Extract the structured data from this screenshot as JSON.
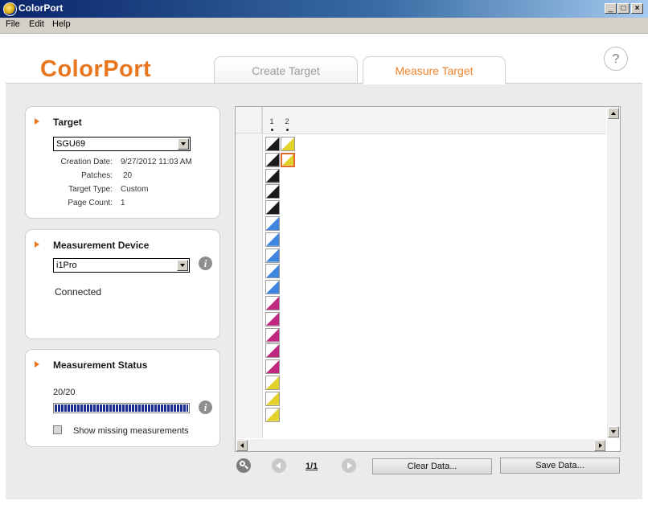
{
  "window": {
    "title": "ColorPort"
  },
  "menu": {
    "items": [
      "File",
      "Edit",
      "Help"
    ]
  },
  "header": {
    "logo": "ColorPort",
    "tabs": [
      {
        "label": "Create Target",
        "active": false
      },
      {
        "label": "Measure Target",
        "active": true
      }
    ],
    "help_label": "?"
  },
  "target_panel": {
    "title": "Target",
    "selected": "SGU69",
    "info": [
      {
        "label": "Creation Date:",
        "value": "9/27/2012 11:03 AM"
      },
      {
        "label": "Patches:",
        "value": "20"
      },
      {
        "label": "Target Type:",
        "value": "Custom"
      },
      {
        "label": "Page Count:",
        "value": "1"
      }
    ]
  },
  "device_panel": {
    "title": "Measurement Device",
    "selected": "i1Pro",
    "status": "Connected",
    "info_icon": "i"
  },
  "status_panel": {
    "title": "Measurement Status",
    "count": "20/20",
    "progress": 1.0,
    "info_icon": "i",
    "checkbox_label": "Show missing measurements",
    "checkbox_checked": false
  },
  "grid": {
    "columns": [
      "1",
      "2"
    ],
    "patches": [
      {
        "col": 1,
        "row": 1,
        "color": "#1a1a1a"
      },
      {
        "col": 2,
        "row": 1,
        "color": "#e3d22a"
      },
      {
        "col": 1,
        "row": 2,
        "color": "#1a1a1a"
      },
      {
        "col": 2,
        "row": 2,
        "color": "#e3d22a",
        "selected": true
      },
      {
        "col": 1,
        "row": 3,
        "color": "#1a1a1a"
      },
      {
        "col": 1,
        "row": 4,
        "color": "#1a1a1a"
      },
      {
        "col": 1,
        "row": 5,
        "color": "#1a1a1a"
      },
      {
        "col": 1,
        "row": 6,
        "color": "#3f86e0"
      },
      {
        "col": 1,
        "row": 7,
        "color": "#3f86e0"
      },
      {
        "col": 1,
        "row": 8,
        "color": "#3f86e0"
      },
      {
        "col": 1,
        "row": 9,
        "color": "#3f86e0"
      },
      {
        "col": 1,
        "row": 10,
        "color": "#3f86e0"
      },
      {
        "col": 1,
        "row": 11,
        "color": "#c0287f"
      },
      {
        "col": 1,
        "row": 12,
        "color": "#c0287f"
      },
      {
        "col": 1,
        "row": 13,
        "color": "#c0287f"
      },
      {
        "col": 1,
        "row": 14,
        "color": "#c0287f"
      },
      {
        "col": 1,
        "row": 15,
        "color": "#c0287f"
      },
      {
        "col": 1,
        "row": 16,
        "color": "#e3d22a"
      },
      {
        "col": 1,
        "row": 17,
        "color": "#e3d22a"
      },
      {
        "col": 1,
        "row": 18,
        "color": "#e3d22a"
      }
    ]
  },
  "pager": {
    "page": "1/1"
  },
  "buttons": {
    "clear": "Clear Data...",
    "save": "Save Data..."
  },
  "colors": {
    "accent": "#e8761f",
    "progress": "#1c2f8f"
  }
}
